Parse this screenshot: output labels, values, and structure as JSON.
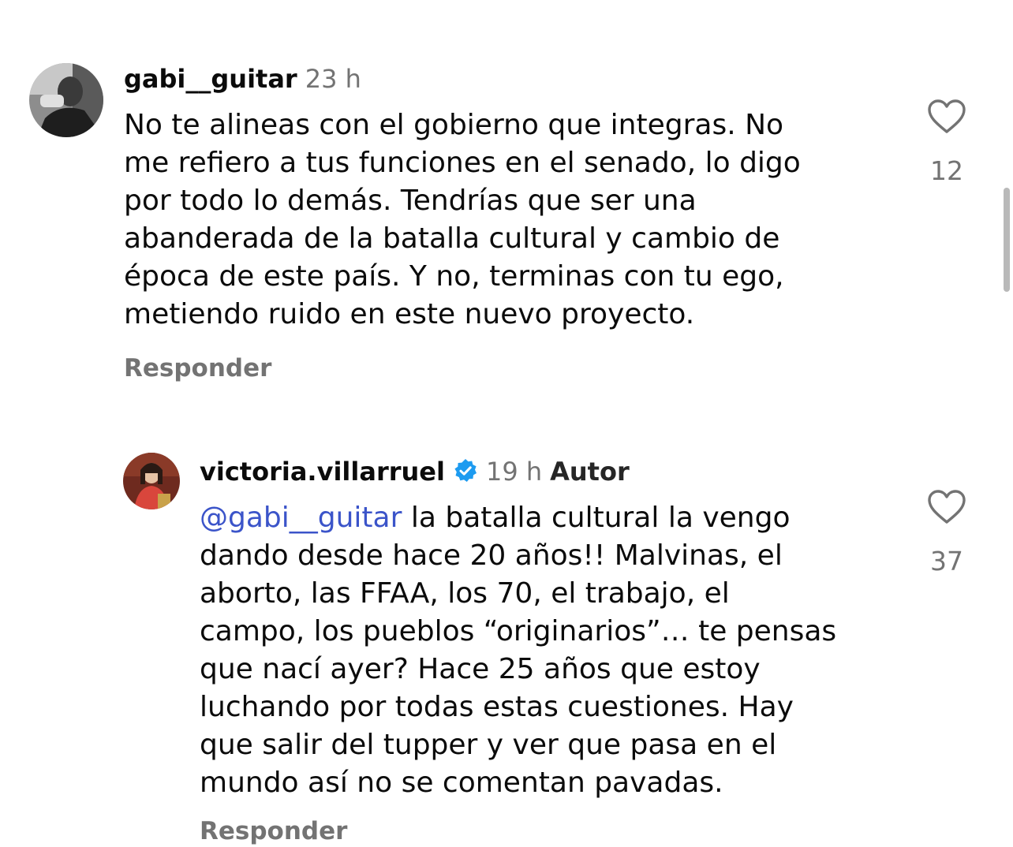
{
  "comments": [
    {
      "username": "gabi__guitar",
      "time": "23 h",
      "lines": [
        "No te alineas con el gobierno que integras. No",
        "me refiero a tus funciones en el senado, lo digo",
        "por todo lo demás. Tendrías que ser una",
        "abanderada de la batalla cultural y cambio de",
        "época de este país. Y no, terminas con tu ego,",
        "metiendo ruido en este nuevo proyecto."
      ],
      "likes": "12",
      "reply_label": "Responder"
    },
    {
      "username": "victoria.villarruel",
      "time": "19 h",
      "author_badge": "Autor",
      "mention": "@gabi__guitar",
      "first_line_rest": " la batalla cultural la vengo",
      "lines": [
        "dando desde hace 20 años!! Malvinas, el",
        "aborto, las FFAA, los 70, el trabajo, el",
        "campo, los pueblos “originarios”… te pensas",
        "que nací ayer? Hace 25 años que estoy",
        "luchando por todas estas cuestiones. Hay",
        "que salir del tupper y ver que pasa en el",
        "mundo así no se comentan pavadas."
      ],
      "likes": "37",
      "reply_label": "Responder"
    }
  ],
  "colors": {
    "mention": "#3b54c9",
    "secondary_text": "#737373",
    "verified_badge": "#1d9bf0"
  },
  "icons": [
    "heart-outline-icon",
    "verified-badge-icon"
  ]
}
